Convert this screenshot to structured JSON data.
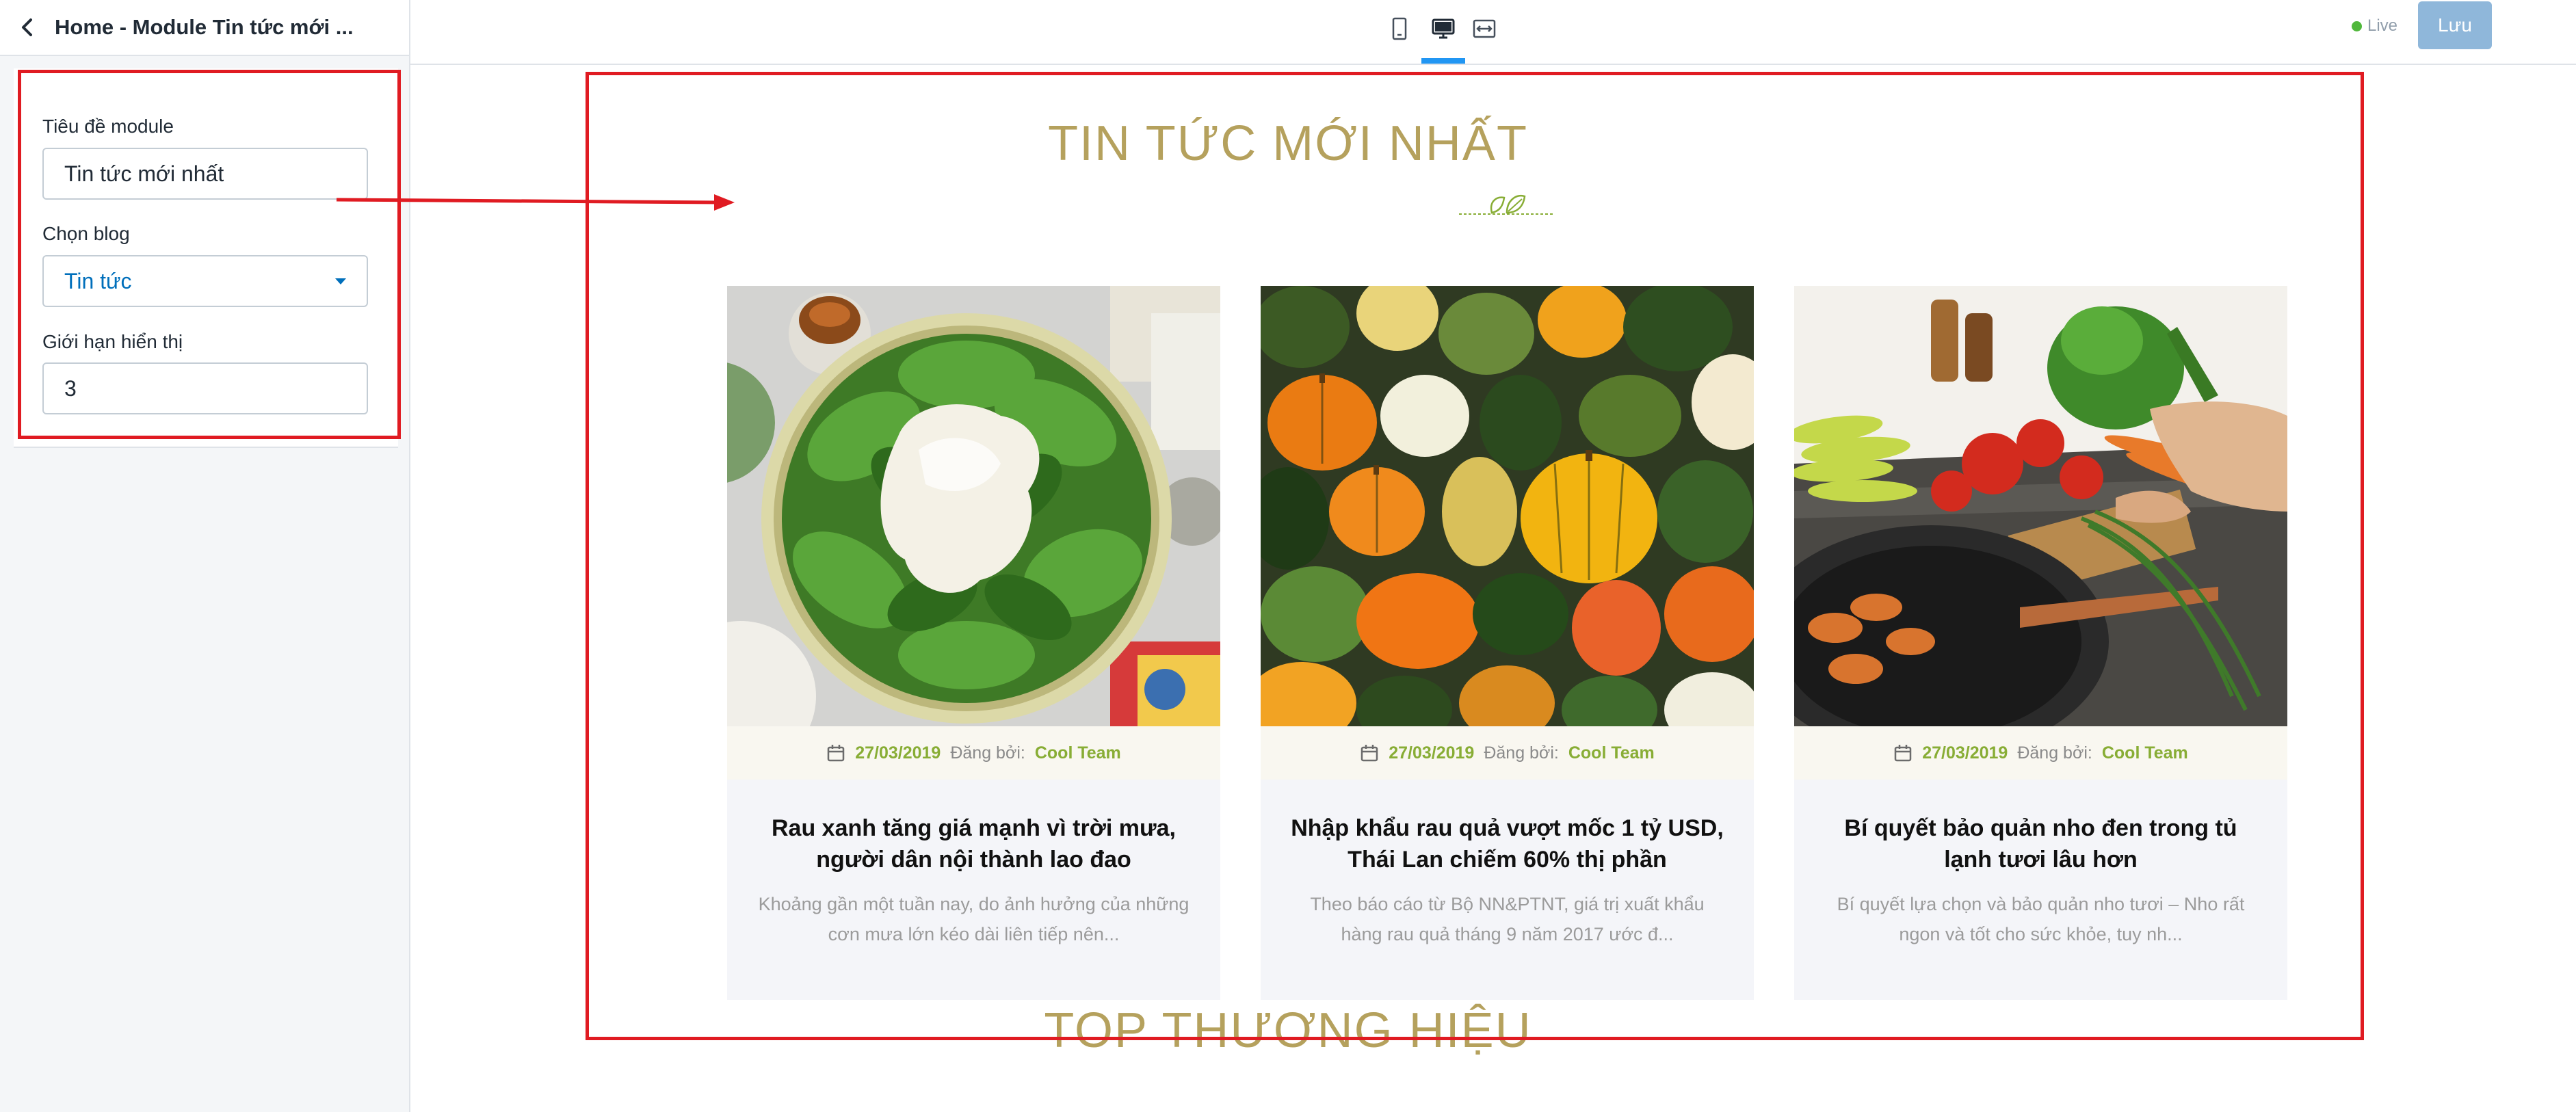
{
  "sidebar": {
    "title": "Home - Module Tin tức mới ...",
    "fields": {
      "module_title": {
        "label": "Tiêu đề module",
        "value": "Tin tức mới nhất"
      },
      "blog": {
        "label": "Chọn blog",
        "value": "Tin tức"
      },
      "limit": {
        "label": "Giới hạn hiển thị",
        "value": "3"
      }
    }
  },
  "topbar": {
    "devices": [
      "mobile-icon",
      "desktop-icon",
      "fullwidth-icon"
    ],
    "active_device": "desktop",
    "status": "Live",
    "save_label": "Lưu"
  },
  "preview": {
    "section_title": "TIN TỨC MỚI NHẤT",
    "next_section_title": "TOP THƯƠNG HIỆU",
    "posts": [
      {
        "date": "27/03/2019",
        "posted_by": "Đăng bởi:",
        "author": "Cool Team",
        "title": "Rau xanh tăng giá mạnh vì trời mưa, người dân nội thành lao đao",
        "excerpt": "Khoảng gần một tuần nay, do ảnh hưởng của những cơn mưa lớn kéo dài liên tiếp nên...",
        "image": "salad-bowl-image"
      },
      {
        "date": "27/03/2019",
        "posted_by": "Đăng bởi:",
        "author": "Cool Team",
        "title": "Nhập khẩu rau quả vượt mốc 1 tỷ USD, Thái Lan chiếm 60% thị phần",
        "excerpt": "Theo báo cáo từ Bộ NN&PTNT, giá trị xuất khẩu hàng rau quả tháng 9 năm 2017 ước đ...",
        "image": "pumpkins-image"
      },
      {
        "date": "27/03/2019",
        "posted_by": "Đăng bởi:",
        "author": "Cool Team",
        "title": "Bí quyết bảo quản nho đen trong tủ lạnh tươi lâu hơn",
        "excerpt": "Bí quyết lựa chọn và bảo quản nho tươi – Nho rất ngon và tốt cho sức khỏe, tuy nh...",
        "image": "kitchen-vegetables-image"
      }
    ]
  },
  "colors": {
    "accent_title": "#b5a15d",
    "meta_green": "#88ad35",
    "highlight_red": "#e01b22",
    "tab_blue": "#2196f3",
    "save_button": "#8fb7da",
    "link_blue": "#006fbb"
  }
}
